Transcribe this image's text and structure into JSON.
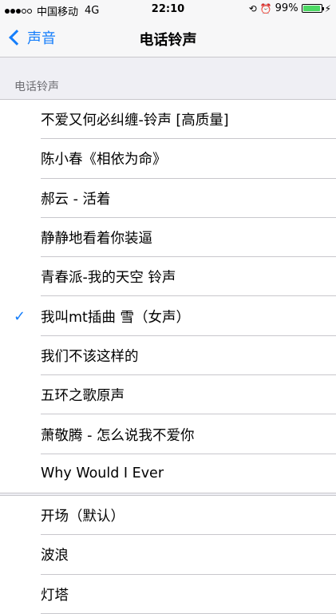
{
  "status_bar": {
    "carrier": "中国移动",
    "network": "4G",
    "time": "22:10",
    "battery_percent": "99%",
    "battery_level": 0.99,
    "battery_color": "#4cd964"
  },
  "nav": {
    "back_label": "声音",
    "title": "电话铃声"
  },
  "section": {
    "header": "电话铃声"
  },
  "ringtones": [
    {
      "label": "不爱又何必纠缠-铃声 [高质量]",
      "selected": false
    },
    {
      "label": "陈小春《相依为命》",
      "selected": false
    },
    {
      "label": "郝云 - 活着",
      "selected": false
    },
    {
      "label": "静静地看着你装逼",
      "selected": false
    },
    {
      "label": "青春派-我的天空 铃声",
      "selected": false
    },
    {
      "label": "我叫mt插曲 雪（女声）",
      "selected": true
    },
    {
      "label": "我们不该这样的",
      "selected": false
    },
    {
      "label": "五环之歌原声",
      "selected": false
    },
    {
      "label": "萧敬腾 - 怎么说我不爱你",
      "selected": false
    },
    {
      "label": "Why Would I Ever",
      "selected": false
    }
  ],
  "default_tones": [
    {
      "label": "开场（默认）",
      "selected": false
    },
    {
      "label": "波浪",
      "selected": false
    },
    {
      "label": "灯塔",
      "selected": false
    }
  ],
  "accent_color": "#157efb"
}
